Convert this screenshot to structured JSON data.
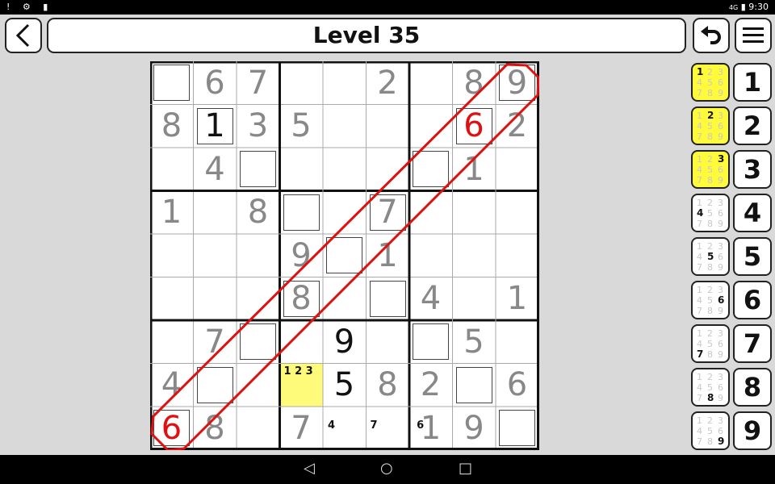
{
  "status_bar": {
    "icons_left": "! ⚙ ▮",
    "network": "4G",
    "time": "9:30"
  },
  "header": {
    "title": "Level 35"
  },
  "icons": {
    "back": "back-arrow-icon",
    "undo": "undo-icon",
    "menu": "hamburger-menu-icon"
  },
  "colors": {
    "given": "#888888",
    "entered": "#111111",
    "error": "#e01010",
    "highlight": "#fffb7a",
    "note_active": "#fffb3a"
  },
  "board": {
    "rows": [
      [
        {
          "v": "",
          "box": true
        },
        {
          "v": "6",
          "s": "given"
        },
        {
          "v": "7",
          "s": "given"
        },
        {
          "v": ""
        },
        {
          "v": ""
        },
        {
          "v": "2",
          "s": "given"
        },
        {
          "v": ""
        },
        {
          "v": "8",
          "s": "given"
        },
        {
          "v": "9",
          "s": "given",
          "box": true
        }
      ],
      [
        {
          "v": "8",
          "s": "given"
        },
        {
          "v": "1",
          "s": "black",
          "box": true
        },
        {
          "v": "3",
          "s": "given"
        },
        {
          "v": "5",
          "s": "given"
        },
        {
          "v": ""
        },
        {
          "v": ""
        },
        {
          "v": ""
        },
        {
          "v": "6",
          "s": "red",
          "box": true
        },
        {
          "v": "2",
          "s": "given"
        }
      ],
      [
        {
          "v": ""
        },
        {
          "v": "4",
          "s": "given"
        },
        {
          "v": "",
          "box": true
        },
        {
          "v": ""
        },
        {
          "v": ""
        },
        {
          "v": ""
        },
        {
          "v": "",
          "box": true
        },
        {
          "v": "1",
          "s": "given"
        },
        {
          "v": ""
        }
      ],
      [
        {
          "v": "1",
          "s": "given"
        },
        {
          "v": ""
        },
        {
          "v": "8",
          "s": "given"
        },
        {
          "v": "",
          "box": true
        },
        {
          "v": ""
        },
        {
          "v": "7",
          "s": "given",
          "box": true
        },
        {
          "v": ""
        },
        {
          "v": ""
        },
        {
          "v": ""
        }
      ],
      [
        {
          "v": ""
        },
        {
          "v": ""
        },
        {
          "v": ""
        },
        {
          "v": "9",
          "s": "given"
        },
        {
          "v": "",
          "box": true
        },
        {
          "v": "1",
          "s": "given"
        },
        {
          "v": ""
        },
        {
          "v": ""
        },
        {
          "v": ""
        }
      ],
      [
        {
          "v": ""
        },
        {
          "v": ""
        },
        {
          "v": ""
        },
        {
          "v": "8",
          "s": "given",
          "box": true
        },
        {
          "v": ""
        },
        {
          "v": "",
          "box": true
        },
        {
          "v": "4",
          "s": "given"
        },
        {
          "v": ""
        },
        {
          "v": "1",
          "s": "given"
        }
      ],
      [
        {
          "v": ""
        },
        {
          "v": "7",
          "s": "given"
        },
        {
          "v": "",
          "box": true
        },
        {
          "v": ""
        },
        {
          "v": "9",
          "s": "black"
        },
        {
          "v": ""
        },
        {
          "v": "",
          "box": true
        },
        {
          "v": "5",
          "s": "given"
        },
        {
          "v": ""
        }
      ],
      [
        {
          "v": "4",
          "s": "given"
        },
        {
          "v": "",
          "box": true
        },
        {
          "v": ""
        },
        {
          "v": "",
          "hl": true,
          "notes": "1 2 3"
        },
        {
          "v": "5",
          "s": "black"
        },
        {
          "v": "8",
          "s": "given"
        },
        {
          "v": "2",
          "s": "given"
        },
        {
          "v": "",
          "box": true
        },
        {
          "v": "6",
          "s": "given"
        }
      ],
      [
        {
          "v": "6",
          "s": "red",
          "box": true
        },
        {
          "v": "8",
          "s": "given"
        },
        {
          "v": ""
        },
        {
          "v": "7",
          "s": "given"
        },
        {
          "v": "",
          "notes": "4"
        },
        {
          "v": "",
          "notes": "7 6"
        },
        {
          "v": "1",
          "s": "given"
        },
        {
          "v": "9",
          "s": "given"
        },
        {
          "v": "",
          "box": true
        }
      ]
    ]
  },
  "note_buttons": [
    {
      "digit": "1",
      "active": true
    },
    {
      "digit": "2",
      "active": true
    },
    {
      "digit": "3",
      "active": true
    },
    {
      "digit": "4",
      "active": false
    },
    {
      "digit": "5",
      "active": false
    },
    {
      "digit": "6",
      "active": false
    },
    {
      "digit": "7",
      "active": false
    },
    {
      "digit": "8",
      "active": false
    },
    {
      "digit": "9",
      "active": false
    }
  ],
  "number_buttons": [
    "1",
    "2",
    "3",
    "4",
    "5",
    "6",
    "7",
    "8",
    "9"
  ],
  "mini_grid": [
    "1",
    "2",
    "3",
    "4",
    "5",
    "6",
    "7",
    "8",
    "9"
  ],
  "nav": {
    "back": "◁",
    "home": "○",
    "recent": "□"
  }
}
